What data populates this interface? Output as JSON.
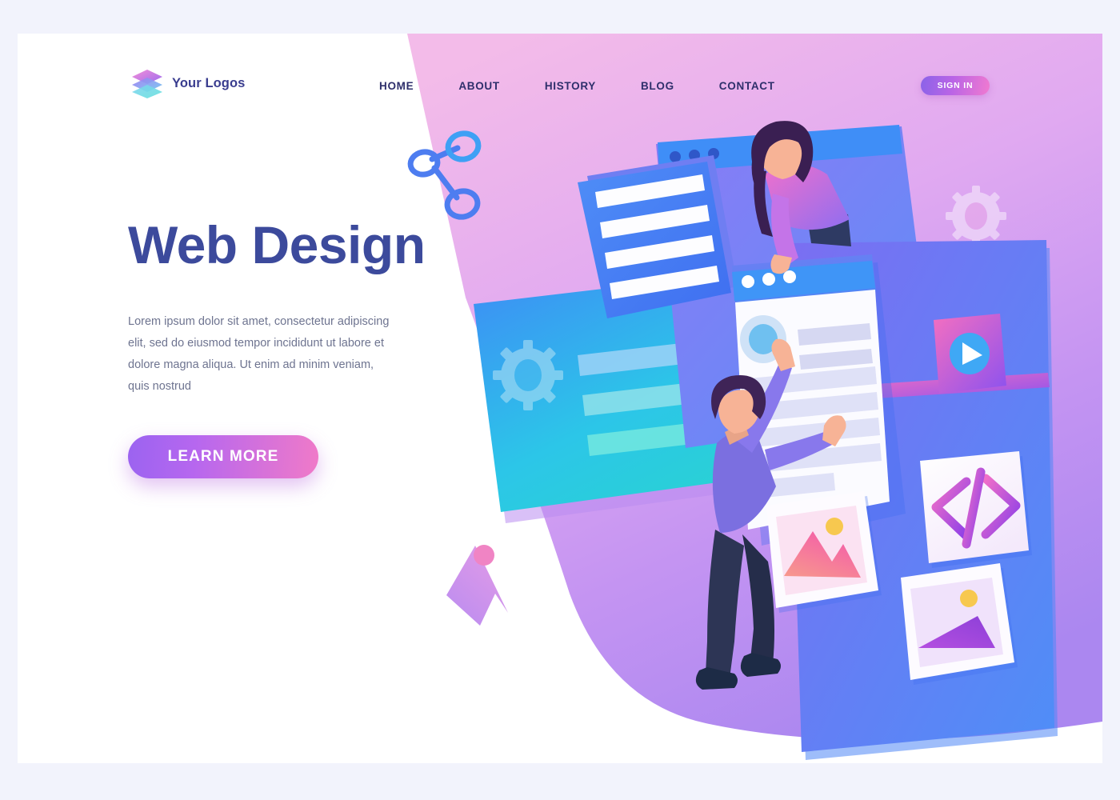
{
  "frame": {
    "outer_background": "#f2f3fc",
    "card_background": "#ffffff"
  },
  "header": {
    "logo": {
      "icon": "stacked-layers-icon",
      "text": "Your Logos",
      "color": "#3a3d8f"
    },
    "nav": [
      {
        "label": "HOME"
      },
      {
        "label": "ABOUT"
      },
      {
        "label": "HISTORY"
      },
      {
        "label": "BLOG"
      },
      {
        "label": "CONTACT"
      }
    ],
    "sign_in_label": "SIGN IN"
  },
  "hero": {
    "title": "Web Design",
    "title_color": "#3c4a9c",
    "paragraph": "Lorem ipsum dolor sit amet, consectetur adipiscing elit, sed do eiusmod tempor incididunt ut labore et dolore magna aliqua. Ut enim ad minim veniam, quis nostrud",
    "cta_label": "LEARN MORE"
  },
  "illustration": {
    "description": "Isometric web-design scene: two people building browser windows and UI cards",
    "background_shape_colors": [
      "#f0b9e8",
      "#dba8f2",
      "#b98df0"
    ],
    "icons": [
      {
        "name": "share-network-icon",
        "color": "#4d7df0"
      },
      {
        "name": "gear-icon-decorative",
        "color": "#ffffff"
      },
      {
        "name": "gear-icon-card",
        "color": "#9fd8ef"
      },
      {
        "name": "image-mountain-icon-floating",
        "color": "#c79af0"
      },
      {
        "name": "play-video-icon",
        "color": "#ffffff"
      },
      {
        "name": "code-brackets-icon",
        "color": "#b152e8"
      },
      {
        "name": "image-mountain-icon-pink",
        "color": "#f571a8"
      },
      {
        "name": "image-mountain-icon-purple",
        "color": "#a14de0"
      }
    ],
    "characters": [
      {
        "name": "woman-character",
        "hair": "#3a1f52",
        "top": "#e06fd0",
        "pants": "#2e3a63"
      },
      {
        "name": "man-character",
        "hair": "#3f2457",
        "top": "#7b6fe0",
        "pants": "#2d3555",
        "shoes": "#1d2b46"
      }
    ]
  }
}
